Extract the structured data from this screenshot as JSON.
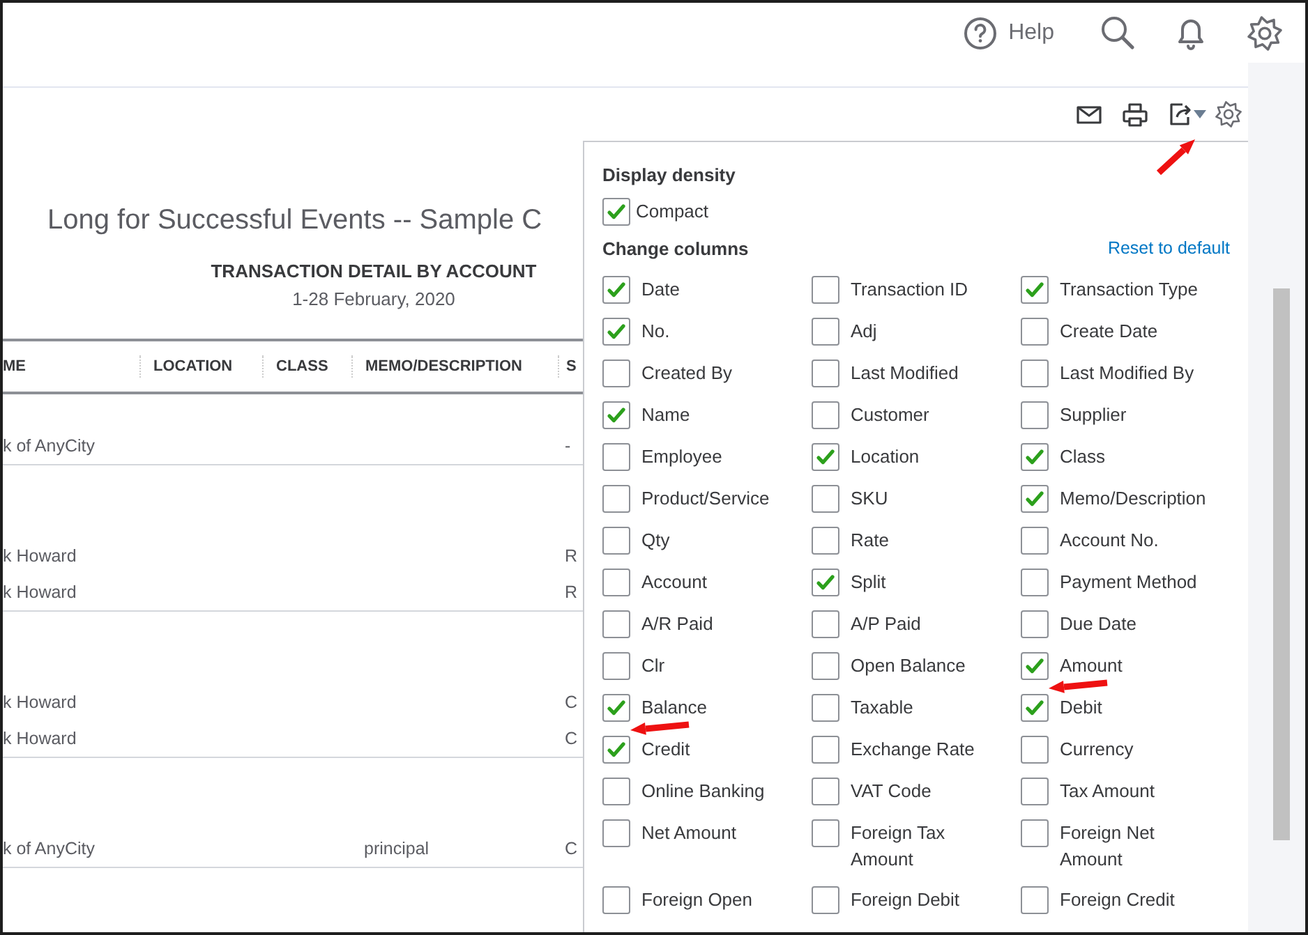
{
  "topbar": {
    "help": "Help"
  },
  "report": {
    "company": "Long for Successful Events -- Sample C",
    "title": "TRANSACTION DETAIL BY ACCOUNT",
    "period": "1-28 February, 2020",
    "columns": [
      "ME",
      "LOCATION",
      "CLASS",
      "MEMO/DESCRIPTION",
      "S"
    ],
    "groups": [
      {
        "rows": [
          {
            "column_1": "k of AnyCity",
            "column_5": "-"
          }
        ]
      },
      {
        "rows": [
          {
            "column_1": "k Howard",
            "column_5": "R"
          },
          {
            "column_1": "k Howard",
            "column_5": "R"
          }
        ]
      },
      {
        "rows": [
          {
            "column_1": "k Howard",
            "column_5": "C"
          },
          {
            "column_1": "k Howard",
            "column_5": "C"
          }
        ]
      },
      {
        "rows": [
          {
            "column_1": "k of AnyCity",
            "column_4": "principal",
            "column_5": "C"
          }
        ]
      }
    ]
  },
  "settings": {
    "density_heading": "Display density",
    "density": [
      {
        "label": "Compact",
        "checked": true
      }
    ],
    "columns_heading": "Change columns",
    "reset_link": "Reset to default",
    "columns": [
      {
        "label": "Date",
        "checked": true
      },
      {
        "label": "Transaction ID",
        "checked": false
      },
      {
        "label": "Transaction Type",
        "checked": true
      },
      {
        "label": "No.",
        "checked": true
      },
      {
        "label": "Adj",
        "checked": false
      },
      {
        "label": "Create Date",
        "checked": false
      },
      {
        "label": "Created By",
        "checked": false
      },
      {
        "label": "Last Modified",
        "checked": false
      },
      {
        "label": "Last Modified By",
        "checked": false
      },
      {
        "label": "Name",
        "checked": true
      },
      {
        "label": "Customer",
        "checked": false
      },
      {
        "label": "Supplier",
        "checked": false
      },
      {
        "label": "Employee",
        "checked": false
      },
      {
        "label": "Location",
        "checked": true
      },
      {
        "label": "Class",
        "checked": true
      },
      {
        "label": "Product/Service",
        "checked": false
      },
      {
        "label": "SKU",
        "checked": false
      },
      {
        "label": "Memo/Description",
        "checked": true
      },
      {
        "label": "Qty",
        "checked": false
      },
      {
        "label": "Rate",
        "checked": false
      },
      {
        "label": "Account No.",
        "checked": false
      },
      {
        "label": "Account",
        "checked": false
      },
      {
        "label": "Split",
        "checked": true
      },
      {
        "label": "Payment Method",
        "checked": false
      },
      {
        "label": "A/R Paid",
        "checked": false
      },
      {
        "label": "A/P Paid",
        "checked": false
      },
      {
        "label": "Due Date",
        "checked": false
      },
      {
        "label": "Clr",
        "checked": false
      },
      {
        "label": "Open Balance",
        "checked": false
      },
      {
        "label": "Amount",
        "checked": true
      },
      {
        "label": "Balance",
        "checked": true
      },
      {
        "label": "Taxable",
        "checked": false
      },
      {
        "label": "Debit",
        "checked": true
      },
      {
        "label": "Credit",
        "checked": true
      },
      {
        "label": "Exchange Rate",
        "checked": false
      },
      {
        "label": "Currency",
        "checked": false
      },
      {
        "label": "Online Banking",
        "checked": false
      },
      {
        "label": "VAT Code",
        "checked": false
      },
      {
        "label": "Tax Amount",
        "checked": false
      },
      {
        "label": "Net Amount",
        "checked": false
      },
      {
        "label": "Foreign Tax Amount",
        "checked": false
      },
      {
        "label": "Foreign Net Amount",
        "checked": false
      },
      {
        "label": "Foreign Open",
        "checked": false
      },
      {
        "label": "Foreign Debit",
        "checked": false
      },
      {
        "label": "Foreign Credit",
        "checked": false
      }
    ]
  }
}
